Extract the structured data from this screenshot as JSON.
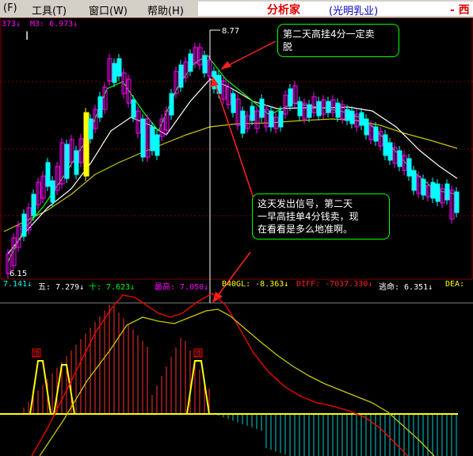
{
  "menu": {
    "items": [
      {
        "label": "(F)"
      },
      {
        "label": "工具(T)"
      },
      {
        "label": "窗口(W)"
      },
      {
        "label": "帮助(H)"
      }
    ]
  },
  "title": {
    "app_name": "分析家",
    "stock_name": "(光明乳业)",
    "right_fragment": "- 西"
  },
  "main_chart": {
    "ma_top_left": "373↓",
    "m3_label": "M3: 6.973↓",
    "high_label": "8.77",
    "low_label": "6.15"
  },
  "callouts": {
    "top": "第二天高挂4分一定卖\n脱",
    "bottom": "这天发出信号，第二天\n一早高挂单4分钱卖，现\n在看看是多么地准啊。"
  },
  "indicator_bar": {
    "v1": "7.141↓",
    "wu": "五: 7.279↓",
    "shi": "十: 7.623↓",
    "zuigao": "最高: 7.050↓",
    "b40": "B40GL: -8.363↓",
    "diff": "DIFF: -7037.330↓",
    "taoming": "逃命: 6.351↓",
    "dea": "DEA:"
  },
  "lower_chart": {
    "markers": [
      "顶",
      "顶"
    ]
  },
  "colors": {
    "up_candle": "#ff00ff",
    "down_candle": "#00ffff",
    "highlight_candle": "#ffff00",
    "ma_short": "#ffffff",
    "ma_mid": "#00ff00",
    "ma_long": "#c8c800",
    "red_line": "#ff0000",
    "baseline": "#ffff00"
  }
}
